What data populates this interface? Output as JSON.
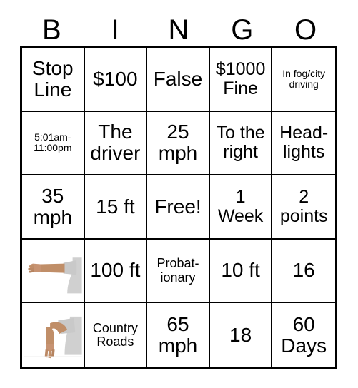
{
  "header": {
    "letters": [
      "B",
      "I",
      "N",
      "G",
      "O"
    ]
  },
  "grid": {
    "rows": [
      [
        {
          "text": "Stop Line",
          "size": "lg"
        },
        {
          "text": "$100",
          "size": "lg"
        },
        {
          "text": "False",
          "size": "lg"
        },
        {
          "text": "$1000 Fine",
          "size": "md"
        },
        {
          "text": "In fog/city driving",
          "size": "xs"
        }
      ],
      [
        {
          "text": "5:01am-11:00pm",
          "size": "xs"
        },
        {
          "text": "The driver",
          "size": "lg"
        },
        {
          "text": "25 mph",
          "size": "lg"
        },
        {
          "text": "To the right",
          "size": "md"
        },
        {
          "text": "Head- lights",
          "size": "md"
        }
      ],
      [
        {
          "text": "35 mph",
          "size": "lg"
        },
        {
          "text": "15 ft",
          "size": "lg"
        },
        {
          "text": "Free!",
          "size": "lg"
        },
        {
          "text": "1 Week",
          "size": "md"
        },
        {
          "text": "2 points",
          "size": "md"
        }
      ],
      [
        {
          "text": "",
          "size": "md",
          "image": "arm-extended-left-turn-signal"
        },
        {
          "text": "100 ft",
          "size": "lg"
        },
        {
          "text": "Probat- ionary",
          "size": "sm"
        },
        {
          "text": "10 ft",
          "size": "lg"
        },
        {
          "text": "16",
          "size": "lg"
        }
      ],
      [
        {
          "text": "",
          "size": "md",
          "image": "arm-down-slow-stop-signal"
        },
        {
          "text": "Country Roads",
          "size": "sm"
        },
        {
          "text": "65 mph",
          "size": "lg"
        },
        {
          "text": "18",
          "size": "lg"
        },
        {
          "text": "60 Days",
          "size": "lg"
        }
      ]
    ]
  },
  "colors": {
    "border": "#000000",
    "background": "#ffffff",
    "text": "#000000",
    "skin": "#c08e६8",
    "sleeve": "#c9c9c9"
  }
}
